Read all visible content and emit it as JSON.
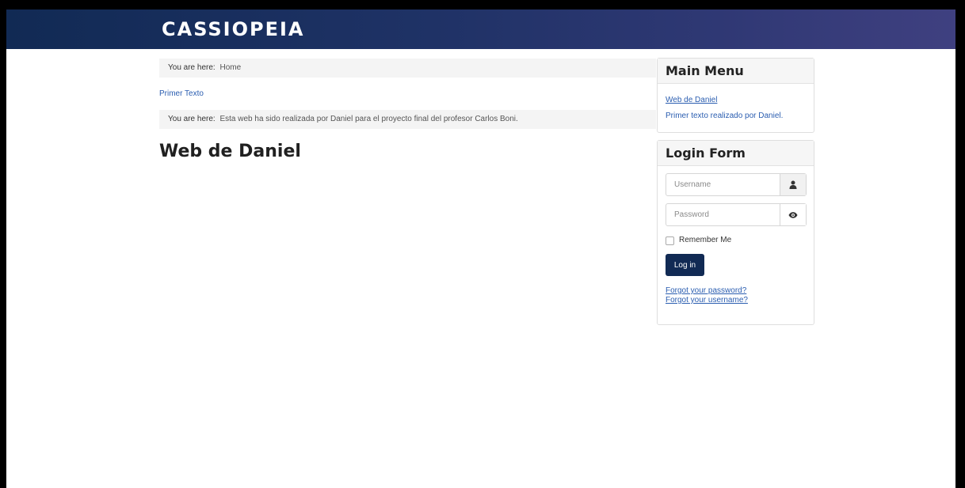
{
  "header": {
    "brand": "CASSIOPEIA"
  },
  "breadcrumbs": [
    {
      "prefix": "You are here:",
      "value": "Home"
    },
    {
      "prefix": "You are here:",
      "value": "Esta web ha sido realizada por Daniel para el proyecto final del profesor Carlos Boni."
    }
  ],
  "main": {
    "primer_link": "Primer Texto",
    "title": "Web de Daniel"
  },
  "main_menu": {
    "title": "Main Menu",
    "items": [
      {
        "label": "Web de Daniel"
      },
      {
        "label": "Primer texto realizado por Daniel."
      }
    ]
  },
  "login_form": {
    "title": "Login Form",
    "username_placeholder": "Username",
    "username_value": "",
    "password_placeholder": "Password",
    "password_value": "",
    "remember_label": "Remember Me",
    "remember_checked": false,
    "login_label": "Log in",
    "forgot_password": "Forgot your password?",
    "forgot_username": "Forgot your username?"
  },
  "icons": {
    "username": "user-icon",
    "password": "eye-icon"
  },
  "colors": {
    "header_start": "#112a54",
    "header_end": "#3f4080",
    "button": "#112a54",
    "link": "#2a5db0"
  }
}
